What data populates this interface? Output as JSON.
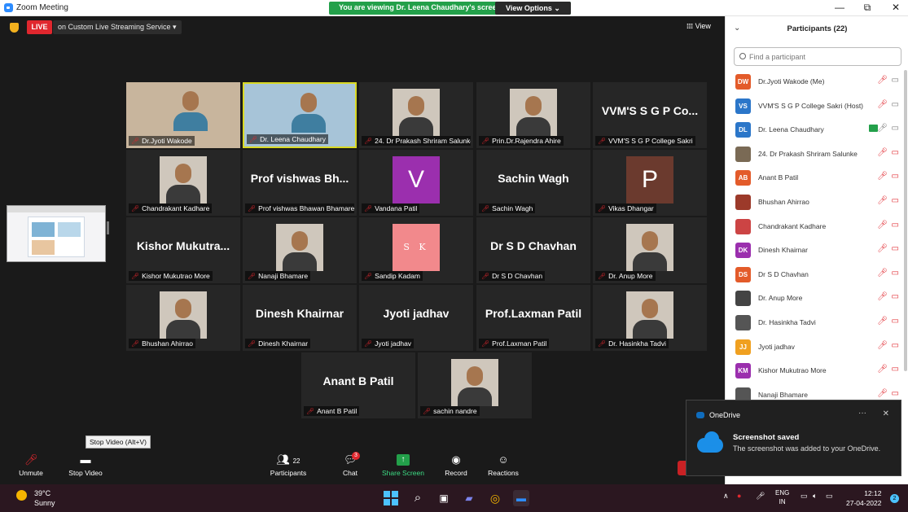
{
  "window": {
    "title": "Zoom Meeting",
    "minimize": "—",
    "restore": "⧉",
    "close": "✕"
  },
  "banner": {
    "message": "You are viewing Dr. Leena Chaudhary's screen",
    "view_options": "View Options ⌄"
  },
  "live": {
    "badge": "LIVE",
    "stream": "on Custom Live Streaming Service  ▾"
  },
  "view_label": "𝍖 View",
  "tiles": [
    {
      "label": "Dr.Jyoti Wakode",
      "kind": "photo",
      "scene": "#c8b59d",
      "pinned": true
    },
    {
      "label": "Dr. Leena Chaudhary",
      "kind": "photo",
      "scene": "#a7c4d8",
      "active": true
    },
    {
      "label": "24. Dr Prakash Shriram Salunke",
      "kind": "photo",
      "scene": "#2a2a2a"
    },
    {
      "label": "Prin.Dr.Rajendra Ahire",
      "kind": "photo",
      "scene": "#2a2a2a"
    },
    {
      "label": "VVM'S S G P College Sakri",
      "kind": "name",
      "name": "VVM'S S G P Co..."
    },
    {
      "label": "Chandrakant Kadhare",
      "kind": "photo",
      "scene": "#2a2a2a"
    },
    {
      "label": "Prof vishwas Bhawan Bhamare",
      "kind": "name",
      "name": "Prof vishwas Bh..."
    },
    {
      "label": "Vandana Patil",
      "kind": "avatar",
      "letter": "V",
      "color": "#9b2fae"
    },
    {
      "label": "Sachin Wagh",
      "kind": "name",
      "name": "Sachin Wagh"
    },
    {
      "label": "Vikas Dhangar",
      "kind": "avatar",
      "letter": "P",
      "color": "#6b3a2e"
    },
    {
      "label": "Kishor Mukutrao More",
      "kind": "name",
      "name": "Kishor Mukutra..."
    },
    {
      "label": "Nanaji Bhamare",
      "kind": "photo",
      "scene": "#2a2a2a"
    },
    {
      "label": "Sandip Kadam",
      "kind": "avatar",
      "letter": "S K",
      "color": "#f2898c",
      "small": true
    },
    {
      "label": "Dr S D Chavhan",
      "kind": "name",
      "name": "Dr S D Chavhan"
    },
    {
      "label": "Dr. Anup More",
      "kind": "photo",
      "scene": "#2a2a2a"
    },
    {
      "label": "Bhushan Ahirrao",
      "kind": "photo",
      "scene": "#2a2a2a"
    },
    {
      "label": "Dinesh Khairnar",
      "kind": "name",
      "name": "Dinesh Khairnar"
    },
    {
      "label": "Jyoti jadhav",
      "kind": "name",
      "name": "Jyoti jadhav"
    },
    {
      "label": "Prof.Laxman Patil",
      "kind": "name",
      "name": "Prof.Laxman Patil"
    },
    {
      "label": "Dr. Hasinkha Tadvi",
      "kind": "photo",
      "scene": "#2a2a2a"
    },
    {
      "label": "Anant B Patil",
      "kind": "name",
      "name": "Anant B Patil"
    },
    {
      "label": "sachin nandre",
      "kind": "photo",
      "scene": "#2a2a2a"
    }
  ],
  "toolbar": {
    "unmute": "Unmute",
    "stop_video": "Stop Video",
    "tooltip": "Stop Video (Alt+V)",
    "participants": "Participants",
    "participants_count": "22",
    "chat": "Chat",
    "chat_badge": "3",
    "share": "Share Screen",
    "record": "Record",
    "reactions": "Reactions"
  },
  "panel": {
    "title": "Participants (22)",
    "search_placeholder": "Find a participant",
    "participants": [
      {
        "name": "Dr.Jyoti Wakode (Me)",
        "initials": "DW",
        "color": "#e35b2a"
      },
      {
        "name": "VVM'S S G P College Sakri (Host)",
        "initials": "VS",
        "color": "#2b76c9"
      },
      {
        "name": "Dr. Leena Chaudhary",
        "initials": "DL",
        "color": "#2b76c9"
      },
      {
        "name": "24. Dr Prakash Shriram Salunke",
        "initials": "",
        "color": "#7a6a55"
      },
      {
        "name": "Anant B Patil",
        "initials": "AB",
        "color": "#e35b2a"
      },
      {
        "name": "Bhushan Ahirrao",
        "initials": "",
        "color": "#9c3a2a"
      },
      {
        "name": "Chandrakant Kadhare",
        "initials": "",
        "color": "#c44"
      },
      {
        "name": "Dinesh Khairnar",
        "initials": "DK",
        "color": "#9b2fae"
      },
      {
        "name": "Dr S D Chavhan",
        "initials": "DS",
        "color": "#e35b2a"
      },
      {
        "name": "Dr. Anup More",
        "initials": "",
        "color": "#444"
      },
      {
        "name": "Dr. Hasinkha Tadvi",
        "initials": "",
        "color": "#555"
      },
      {
        "name": "Jyoti jadhav",
        "initials": "JJ",
        "color": "#f0a020"
      },
      {
        "name": "Kishor Mukutrao More",
        "initials": "KM",
        "color": "#9b2fae"
      },
      {
        "name": "Nanaji Bhamare",
        "initials": "",
        "color": "#555"
      }
    ]
  },
  "toast": {
    "app": "OneDrive",
    "title": "Screenshot saved",
    "body": "The screenshot was added to your OneDrive.",
    "dots": "···",
    "close": "✕"
  },
  "taskbar": {
    "temp": "39°C",
    "condition": "Sunny",
    "lang1": "ENG",
    "lang2": "IN",
    "time": "12:12",
    "date": "27-04-2022",
    "notif": "2"
  }
}
